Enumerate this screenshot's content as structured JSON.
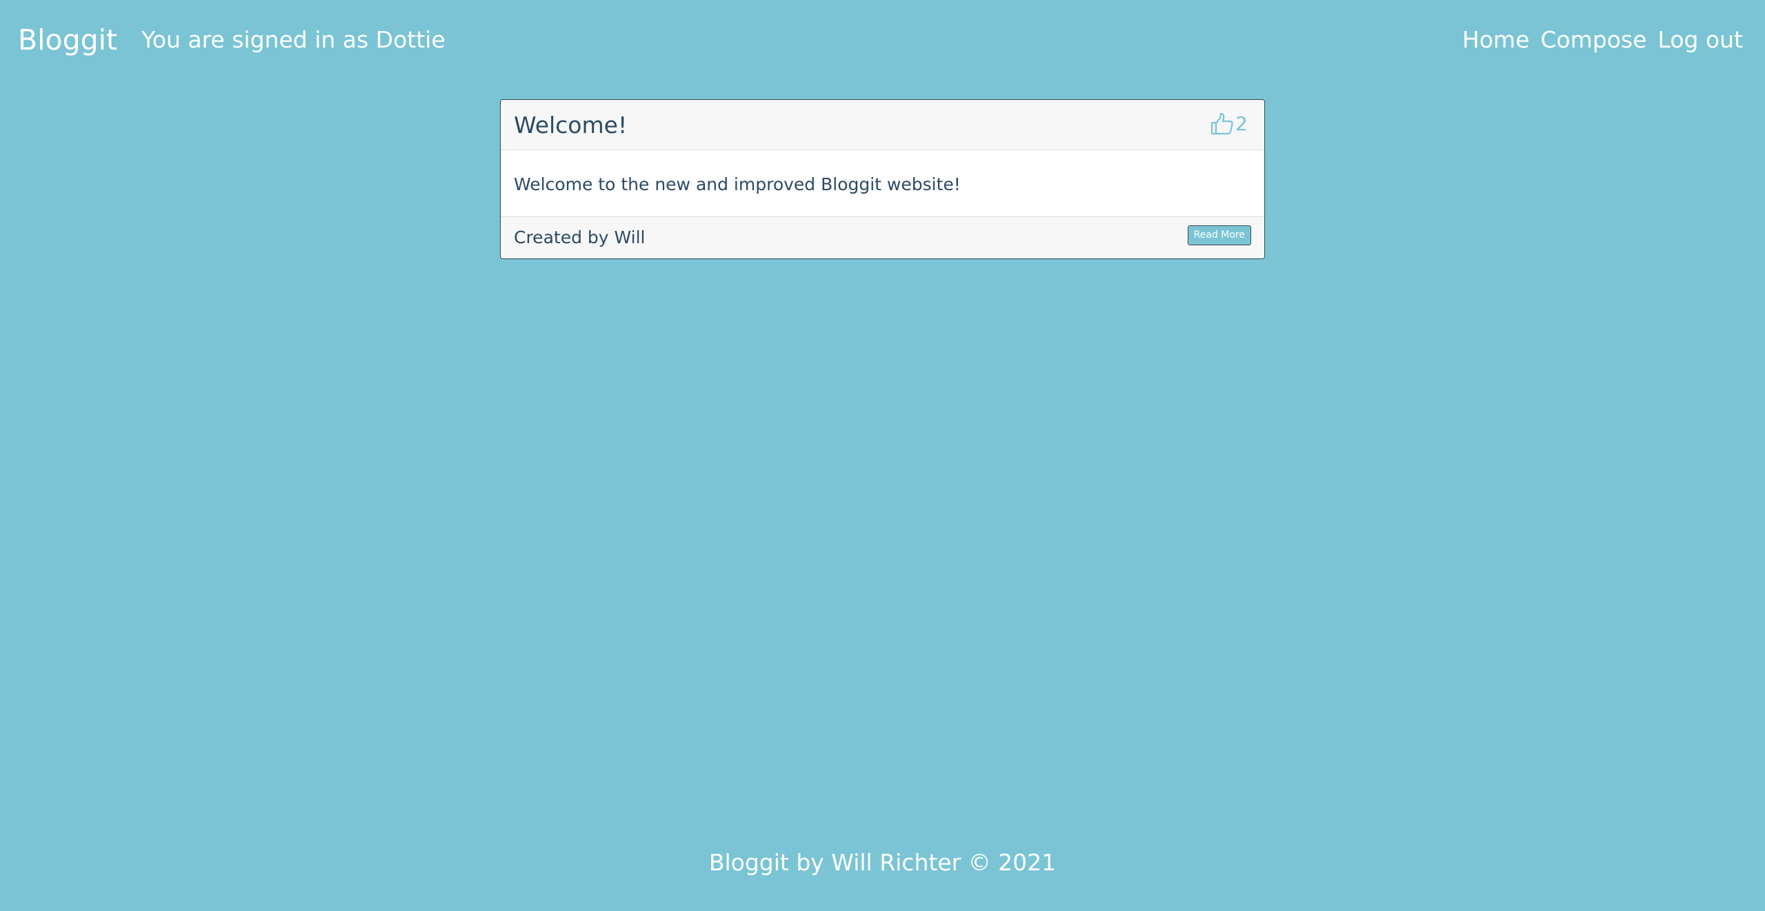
{
  "navbar": {
    "brand": "Bloggit",
    "signed_in_text": "You are signed in as Dottie",
    "links": [
      {
        "label": "Home"
      },
      {
        "label": "Compose"
      },
      {
        "label": "Log out"
      }
    ]
  },
  "post": {
    "title": "Welcome!",
    "like_icon": "thumbs-up-icon",
    "like_count": "2",
    "body": "Welcome to the new and improved Bloggit website!",
    "author_line": "Created by Will",
    "read_more_label": "Read More"
  },
  "footer": {
    "text": "Bloggit by Will Richter © 2021"
  },
  "colors": {
    "background": "#7ac4d5",
    "card_text": "#2c4a66",
    "accent": "#7ac4d5"
  }
}
